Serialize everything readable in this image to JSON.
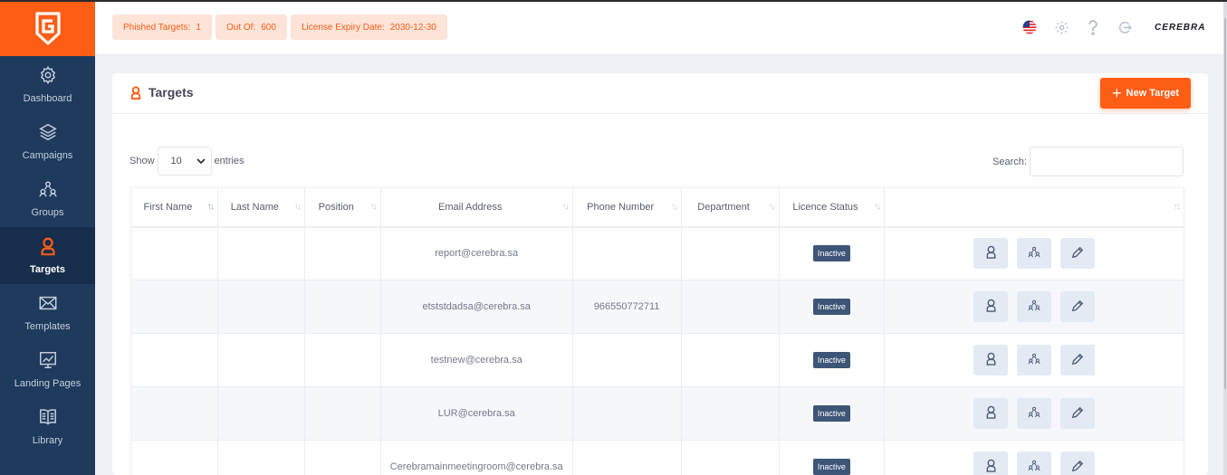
{
  "colors": {
    "brand": "#fd5d14",
    "sidebar": "#1e3a5c",
    "status_badge": "#3d5577"
  },
  "sidebar": {
    "logo_icon": "shield-g-logo",
    "items": [
      {
        "label": "Dashboard",
        "icon": "gear-icon",
        "active": false
      },
      {
        "label": "Campaigns",
        "icon": "layers-icon",
        "active": false
      },
      {
        "label": "Groups",
        "icon": "group-icon",
        "active": false
      },
      {
        "label": "Targets",
        "icon": "person-icon",
        "active": true
      },
      {
        "label": "Templates",
        "icon": "envelope-icon",
        "active": false
      },
      {
        "label": "Landing Pages",
        "icon": "chart-icon",
        "active": false
      },
      {
        "label": "Library",
        "icon": "book-icon",
        "active": false
      }
    ]
  },
  "header": {
    "badges": [
      {
        "label": "Phished Targets:",
        "value": "1"
      },
      {
        "label": "Out Of:",
        "value": "600"
      },
      {
        "label": "License Expiry Date:",
        "value": "2030-12-30"
      }
    ],
    "icons": [
      "us-flag-icon",
      "gear-icon",
      "help-icon",
      "logout-icon"
    ],
    "brand_text": "CEREBRA"
  },
  "card": {
    "title": "Targets",
    "title_icon": "person-icon",
    "new_button": "New Target",
    "show_label": "Show",
    "entries_value": "10",
    "entries_label": "entries",
    "search_label": "Search:"
  },
  "table": {
    "columns": [
      "First Name",
      "Last Name",
      "Position",
      "Email Address",
      "Phone Number",
      "Department",
      "Licence Status",
      ""
    ],
    "rows": [
      {
        "first_name": "",
        "last_name": "",
        "position": "",
        "email": "report@cerebra.sa",
        "phone": "",
        "department": "",
        "status": "Inactive"
      },
      {
        "first_name": "",
        "last_name": "",
        "position": "",
        "email": "etststdadsa@cerebra.sa",
        "phone": "966550772711",
        "department": "",
        "status": "Inactive"
      },
      {
        "first_name": "",
        "last_name": "",
        "position": "",
        "email": "testnew@cerebra.sa",
        "phone": "",
        "department": "",
        "status": "Inactive"
      },
      {
        "first_name": "",
        "last_name": "",
        "position": "",
        "email": "LUR@cerebra.sa",
        "phone": "",
        "department": "",
        "status": "Inactive"
      },
      {
        "first_name": "",
        "last_name": "",
        "position": "",
        "email": "Cerebramainmeetingroom@cerebra.sa",
        "phone": "",
        "department": "",
        "status": "Inactive"
      }
    ],
    "row_action_icons": [
      "person-icon",
      "group-icon",
      "pencil-icon"
    ]
  }
}
